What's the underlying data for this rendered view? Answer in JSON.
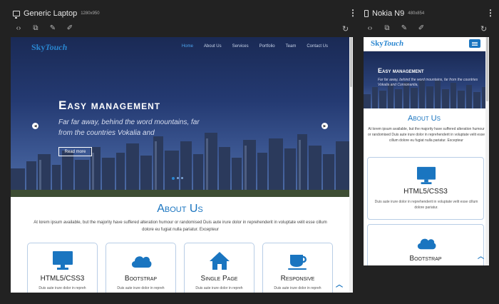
{
  "devices": {
    "laptop": {
      "name": "Generic Laptop",
      "dims": "1280x950"
    },
    "mobile": {
      "name": "Nokia N9",
      "dims": "480x854"
    }
  },
  "toolbar_icons": [
    "code-icon",
    "screenshot-icon",
    "inspect-icon",
    "edit-icon"
  ],
  "site": {
    "logo_a": "Sky",
    "logo_b": "Touch",
    "nav": [
      "Home",
      "About Us",
      "Services",
      "Portfolio",
      "Team",
      "Contact Us"
    ],
    "hero_title": "Easy management",
    "hero_sub": "Far far away, behind the word mountains, far from the countries Vokalia and",
    "hero_sub_mobile": "Far far away, behind the word mountains, far from the countries Vokalia and Consonantia,",
    "read_more": "Read more",
    "about_title": "About Us",
    "about_text": "At lorem ipsum available, but the majority have suffered alteration humour or randomised Duis aute irure dolor in reprehenderit in voluptate velit esse cillum dolore eu fugiat nulla pariatur. Excepteur",
    "cards": [
      {
        "title": "HTML5/CSS3",
        "desc": "Duis aute irure dolor in repreh",
        "icon": "monitor-icon"
      },
      {
        "title": "Bootstrap",
        "desc": "Duis aute irure dolor in repreh",
        "icon": "cloud-icon"
      },
      {
        "title": "Single Page",
        "desc": "Duis aute irure dolor in repreh",
        "icon": "home-icon"
      },
      {
        "title": "Responsive",
        "desc": "Duis aute irure dolor in repreh",
        "icon": "coffee-cup-icon"
      }
    ],
    "mobile_card_desc": "Duis aute irure dolor in reprehenderit in voluptate velit esse cillum dolore pariatur."
  },
  "colors": {
    "accent": "#1a75c0",
    "logo": "#2a86d0",
    "nav_active": "#4ea6f0"
  }
}
